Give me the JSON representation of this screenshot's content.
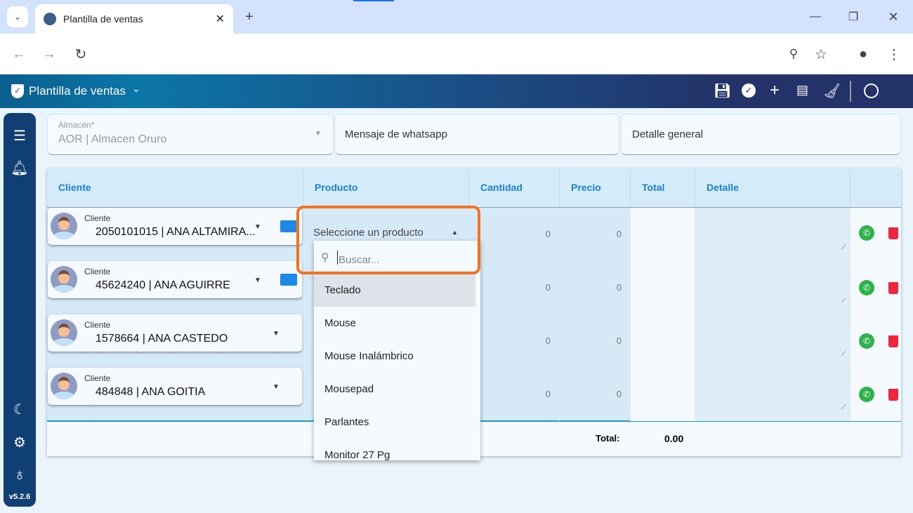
{
  "browser": {
    "tab_title": "Plantilla de ventas"
  },
  "app": {
    "title": "Plantilla de ventas",
    "version": "v5.2.6",
    "toolbar_icons": [
      "save-icon",
      "check-circle-icon",
      "plus-icon",
      "receipt-check-icon",
      "broom-icon",
      "account-icon"
    ]
  },
  "filters": {
    "almacen_label": "Almacén*",
    "almacen_value": "AOR | Almacen Oruro",
    "whatsapp_placeholder": "Mensaje de whatsapp",
    "detalle_placeholder": "Detalle general"
  },
  "table": {
    "headers": [
      "Cliente",
      "Producto",
      "Cantidad",
      "Precio",
      "Total",
      "Detalle"
    ],
    "rows": [
      {
        "cliente_label": "Cliente",
        "cliente": "2050101015 | ANA ALTAMIRA...",
        "producto": "Seleccione un producto",
        "cantidad": "0",
        "precio": "0"
      },
      {
        "cliente_label": "Cliente",
        "cliente": "45624240 | ANA AGUIRRE",
        "cantidad": "0",
        "precio": "0"
      },
      {
        "cliente_label": "Cliente",
        "cliente": "1578664 | ANA CASTEDO",
        "cantidad": "0",
        "precio": "0"
      },
      {
        "cliente_label": "Cliente",
        "cliente": "484848 | ANA GOITIA",
        "cantidad": "0",
        "precio": "0"
      }
    ],
    "total_label": "Total:",
    "total_value": "0.00"
  },
  "dropdown": {
    "search_placeholder": "Buscar...",
    "options": [
      "Teclado",
      "Mouse",
      "Mouse Inalámbrico",
      "Mousepad",
      "Parlantes",
      "Monitor 27 Pg"
    ],
    "highlight_color": "#f47321"
  }
}
